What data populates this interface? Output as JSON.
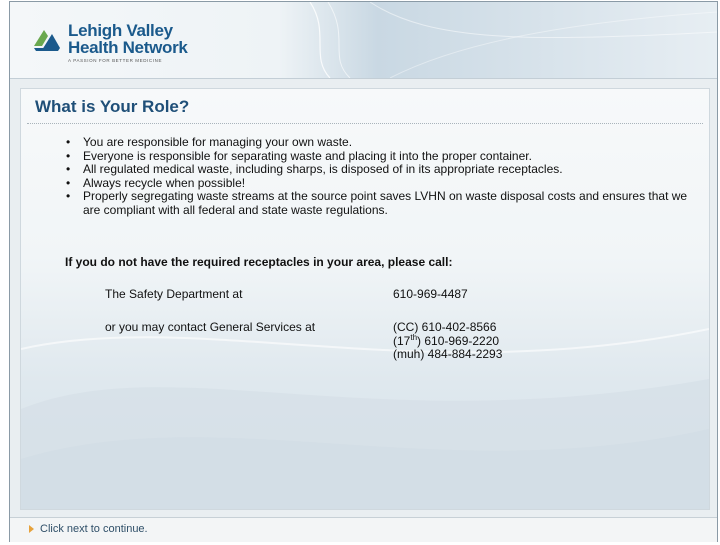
{
  "header": {
    "logo": {
      "name_line1": "Lehigh Valley",
      "name_line2": "Health Network",
      "tagline": "A PASSION FOR BETTER MEDICINE"
    }
  },
  "content": {
    "title": "What is Your Role?",
    "bullets": [
      "You are responsible for managing your own waste.",
      "Everyone is responsible for separating waste and placing it into the proper container.",
      "All regulated medical waste, including sharps, is disposed of in its appropriate receptacles.",
      "Always recycle when possible!",
      "Properly segregating waste streams at the source point saves LVHN on waste disposal costs and ensures that we are compliant with all federal and state waste regulations."
    ],
    "bullet_glyph": "•",
    "call_heading": "If you do not have the required receptacles in your area, please call:",
    "contacts": {
      "safety_label": "The Safety Department at",
      "safety_phone": "610-969-4487",
      "general_label": "or you may contact General Services at",
      "cc_phone": "(CC) 610-402-8566",
      "seventeenth_prefix": "(17",
      "seventeenth_sup": "th",
      "seventeenth_phone": ") 610-969-2220",
      "muh_phone": "(muh) 484-884-2293"
    }
  },
  "footer": {
    "instruction": "Click next to continue."
  },
  "colors": {
    "title": "#1f4f78",
    "logo_blue": "#1b5a8c",
    "logo_green": "#6aa84f",
    "footer_arrow": "#e6a23c"
  }
}
